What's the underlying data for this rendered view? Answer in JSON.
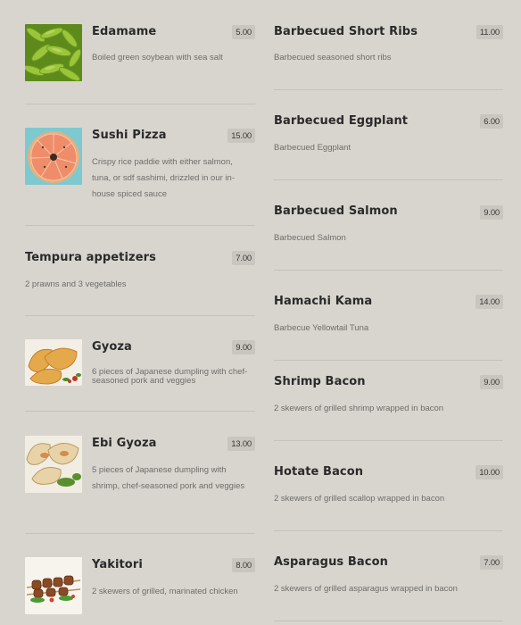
{
  "left_items": [
    {
      "name": "Edamame",
      "price": "5.00",
      "desc": "Boiled green soybean with sea salt",
      "image": "edamame-photo"
    },
    {
      "name": "Sushi Pizza",
      "price": "15.00",
      "desc": "Crispy rice paddie with either salmon, tuna, or sdf sashimi, drizzled in our in-house spiced sauce",
      "image": "sushi-pizza-photo"
    },
    {
      "name": "Tempura appetizers",
      "price": "7.00",
      "desc": "2 prawns and 3 vegetables",
      "image": ""
    },
    {
      "name": "Gyoza",
      "price": "9.00",
      "desc": "6 pieces of Japanese dumpling with chef-seasoned pork and veggies",
      "image": "gyoza-photo"
    },
    {
      "name": "Ebi Gyoza",
      "price": "13.00",
      "desc": "5 pieces of Japanese dumpling with shrimp, chef-seasoned pork and veggies",
      "image": "ebi-gyoza-photo"
    },
    {
      "name": "Yakitori",
      "price": "8.00",
      "desc": "2 skewers of grilled, marinated chicken",
      "image": "yakitori-photo"
    }
  ],
  "right_items": [
    {
      "name": "Barbecued Short Ribs",
      "price": "11.00",
      "desc": "Barbecued seasoned short ribs"
    },
    {
      "name": "Barbecued Eggplant",
      "price": "6.00",
      "desc": "Barbecued Eggplant"
    },
    {
      "name": "Barbecued Salmon",
      "price": "9.00",
      "desc": "Barbecued Salmon"
    },
    {
      "name": "Hamachi Kama",
      "price": "14.00",
      "desc": "Barbecue Yellowtail Tuna"
    },
    {
      "name": "Shrimp Bacon",
      "price": "9.00",
      "desc": "2 skewers of grilled shrimp wrapped in bacon"
    },
    {
      "name": "Hotate Bacon",
      "price": "10.00",
      "desc": "2 skewers of grilled scallop wrapped in bacon"
    },
    {
      "name": "Asparagus Bacon",
      "price": "7.00",
      "desc": "2 skewers of grilled asparagus wrapped in bacon"
    }
  ]
}
